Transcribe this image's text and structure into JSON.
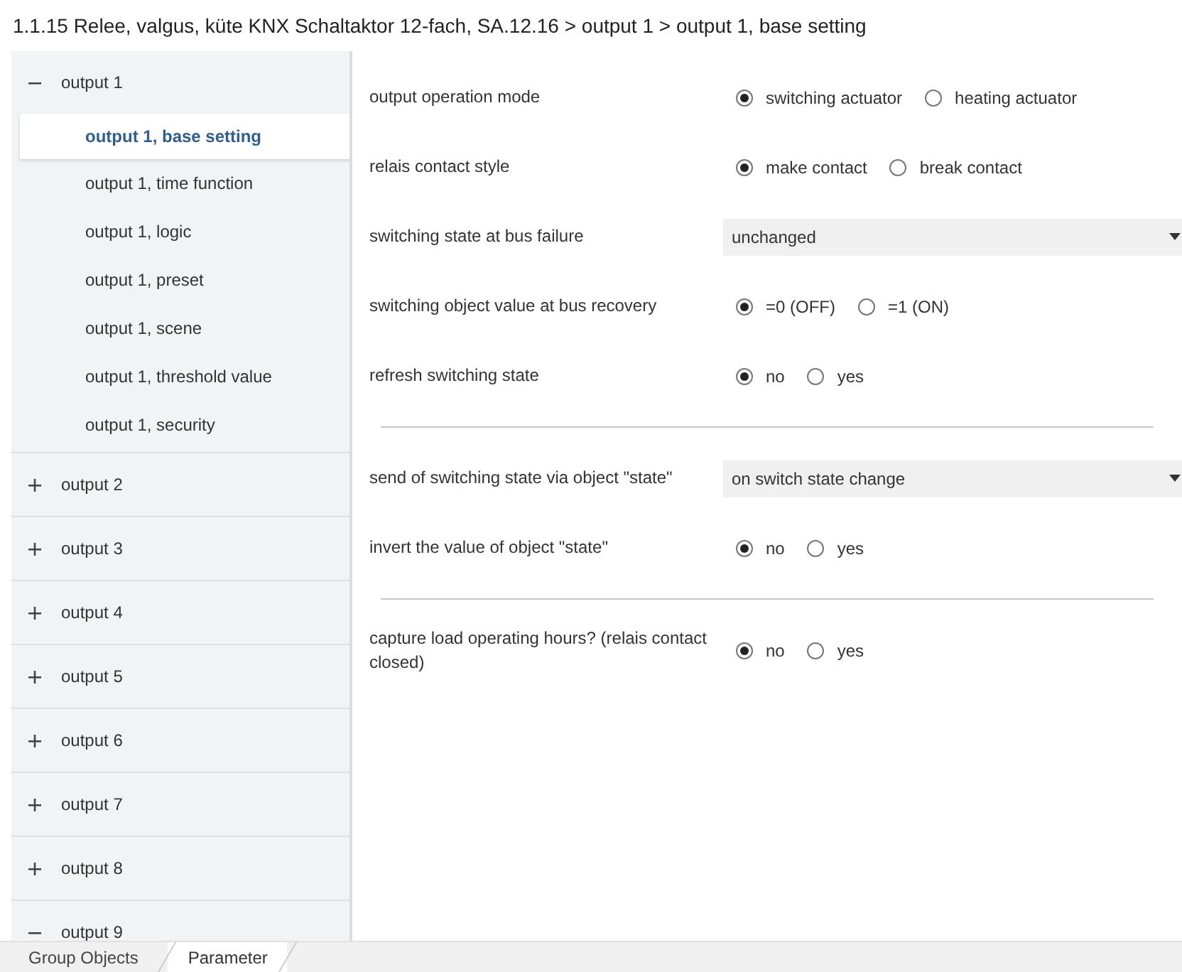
{
  "title": "1.1.15 Relee, valgus, küte KNX Schaltaktor 12-fach, SA.12.16 > output 1 > output 1, base setting",
  "sidebar": {
    "items": [
      {
        "label": "output 1",
        "expanded": true,
        "children": [
          {
            "label": "output 1, base setting",
            "selected": true
          },
          {
            "label": "output 1, time function",
            "selected": false
          },
          {
            "label": "output 1, logic",
            "selected": false
          },
          {
            "label": "output 1, preset",
            "selected": false
          },
          {
            "label": "output 1, scene",
            "selected": false
          },
          {
            "label": "output 1, threshold value",
            "selected": false
          },
          {
            "label": "output 1, security",
            "selected": false
          }
        ]
      },
      {
        "label": "output 2",
        "expanded": false
      },
      {
        "label": "output 3",
        "expanded": false
      },
      {
        "label": "output 4",
        "expanded": false
      },
      {
        "label": "output 5",
        "expanded": false
      },
      {
        "label": "output 6",
        "expanded": false
      },
      {
        "label": "output 7",
        "expanded": false
      },
      {
        "label": "output 8",
        "expanded": false
      },
      {
        "label": "output 9",
        "expanded": true
      }
    ]
  },
  "sections": [
    {
      "rows": [
        {
          "kind": "radio",
          "label": "output operation mode",
          "options": [
            {
              "label": "switching actuator",
              "selected": true
            },
            {
              "label": "heating actuator",
              "selected": false
            }
          ]
        },
        {
          "kind": "radio",
          "label": "relais contact style",
          "options": [
            {
              "label": "make contact",
              "selected": true
            },
            {
              "label": "break contact",
              "selected": false
            }
          ]
        },
        {
          "kind": "dropdown",
          "label": "switching state at bus failure",
          "value": "unchanged"
        },
        {
          "kind": "radio",
          "label": "switching object value at bus recovery",
          "options": [
            {
              "label": "=0 (OFF)",
              "selected": true
            },
            {
              "label": "=1 (ON)",
              "selected": false
            }
          ]
        },
        {
          "kind": "radio",
          "label": "refresh switching state",
          "options": [
            {
              "label": "no",
              "selected": true
            },
            {
              "label": "yes",
              "selected": false
            }
          ]
        }
      ]
    },
    {
      "rows": [
        {
          "kind": "dropdown",
          "label": "send of switching state via object \"state\"",
          "value": "on switch state change"
        },
        {
          "kind": "radio",
          "label": "invert the value of object \"state\"",
          "options": [
            {
              "label": "no",
              "selected": true
            },
            {
              "label": "yes",
              "selected": false
            }
          ]
        }
      ]
    },
    {
      "rows": [
        {
          "kind": "radio",
          "label": "capture load operating hours? (relais contact closed)",
          "options": [
            {
              "label": "no",
              "selected": true
            },
            {
              "label": "yes",
              "selected": false
            }
          ]
        }
      ]
    }
  ],
  "tabs": [
    {
      "label": "Group Objects",
      "selected": false
    },
    {
      "label": "Parameter",
      "selected": true
    }
  ]
}
